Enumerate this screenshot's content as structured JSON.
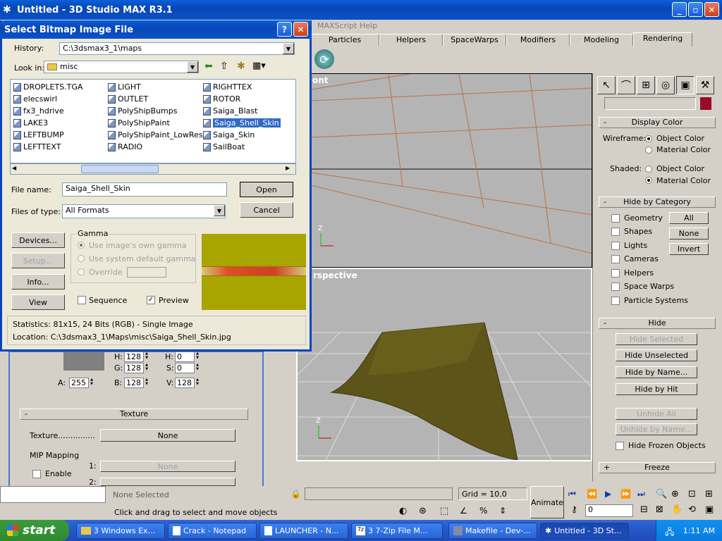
{
  "main_window": {
    "title": "Untitled - 3D Studio MAX R3.1",
    "menu": [
      "MAXScript",
      "Help"
    ]
  },
  "tabs": [
    "Particles",
    "Helpers",
    "SpaceWarps",
    "Modifiers",
    "Modeling",
    "Rendering"
  ],
  "viewports": {
    "front_label": "ont",
    "persp_label": "rspective"
  },
  "command_panel": {
    "display_color": {
      "header": "Display Color",
      "wireframe_label": "Wireframe:",
      "shaded_label": "Shaded:",
      "object_color": "Object Color",
      "material_color": "Material Color",
      "swatch_color": "#9a0a2a"
    },
    "hide_by_category": {
      "header": "Hide by Category",
      "items": [
        "Geometry",
        "Shapes",
        "Lights",
        "Cameras",
        "Helpers",
        "Space Warps",
        "Particle Systems"
      ],
      "all": "All",
      "none": "None",
      "invert": "Invert"
    },
    "hide": {
      "header": "Hide",
      "hide_selected": "Hide Selected",
      "hide_unselected": "Hide Unselected",
      "hide_by_name": "Hide by Name...",
      "hide_by_hit": "Hide by Hit",
      "unhide_all": "Unhide All",
      "unhide_by_name": "Unhide by Name...",
      "hide_frozen": "Hide Frozen Objects"
    },
    "freeze_header": "Freeze"
  },
  "dialog": {
    "title": "Select Bitmap Image File",
    "history_label": "History:",
    "history_value": "C:\\3dsmax3_1\\maps",
    "lookin_label": "Look in:",
    "lookin_value": "misc",
    "files_col1": [
      "DROPLETS.TGA",
      "elecswirl",
      "fx3_hdrive",
      "LAKE3",
      "LEFTBUMP",
      "LEFTTEXT"
    ],
    "files_col2": [
      "LIGHT",
      "OUTLET",
      "PolyShipBumps",
      "PolyShipPaint",
      "PolyShipPaint_LowRes",
      "RADIO"
    ],
    "files_col3": [
      "RIGHTTEX",
      "ROTOR",
      "Saiga_Blast",
      "Saiga_Shell_Skin",
      "Saiga_Skin",
      "SailBoat"
    ],
    "filename_label": "File name:",
    "filename_value": "Saiga_Shell_Skin",
    "filetype_label": "Files of type:",
    "filetype_value": "All Formats",
    "open": "Open",
    "cancel": "Cancel",
    "devices": "Devices...",
    "setup": "Setup...",
    "info": "Info...",
    "view": "View",
    "gamma_label": "Gamma",
    "gamma_own": "Use image's own gamma",
    "gamma_default": "Use system default gamma",
    "gamma_override": "Override",
    "sequence": "Sequence",
    "preview": "Preview",
    "statistics": "Statistics:  81x15, 24 Bits (RGB) - Single Image",
    "location": "Location:   C:\\3dsmax3_1\\Maps\\misc\\Saiga_Shell_Skin.jpg"
  },
  "material_panel": {
    "h_label": "H:",
    "h_value": "128",
    "h2_label": "H:",
    "h2_value": "0",
    "a_label": "A:",
    "a_value": "255",
    "g_label": "G:",
    "g_value": "128",
    "s_label": "S:",
    "s_value": "0",
    "b_label": "B:",
    "b_value": "128",
    "v_label": "V:",
    "v_value": "128",
    "texture_header": "Texture",
    "texture_label": "Texture...............",
    "texture_value": "None",
    "mip_label": "MIP Mapping",
    "enable": "Enable",
    "mip1": "1:",
    "mip2": "2:",
    "mip_none": "None"
  },
  "status": {
    "selection": "None Selected",
    "prompt": "Click and drag to select and move objects",
    "grid": "Grid = 10.0",
    "animate": "Animate",
    "frame": "0"
  },
  "taskbar": {
    "start": "start",
    "tasks": [
      "3 Windows Ex...",
      "Crack - Notepad",
      "LAUNCHER - N...",
      "3 7-Zip File M...",
      "Makefile - Dev-...",
      "Untitled - 3D St..."
    ],
    "clock": "1:11 AM"
  }
}
